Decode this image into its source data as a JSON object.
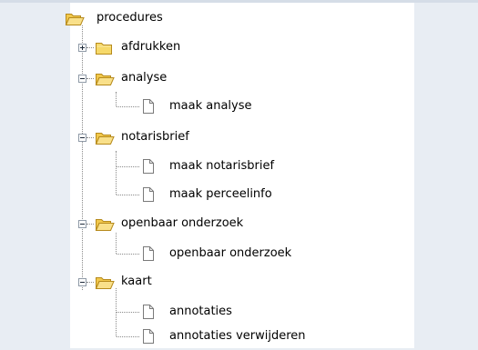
{
  "tree": {
    "root": {
      "label": "procedures",
      "icon": "open-folder-icon",
      "expanded": true
    },
    "items": [
      {
        "label": "afdrukken",
        "icon": "folder-icon",
        "expanded": false
      },
      {
        "label": "analyse",
        "icon": "open-folder-icon",
        "expanded": true
      },
      {
        "label": "maak analyse",
        "icon": "document-icon"
      },
      {
        "label": "notarisbrief",
        "icon": "open-folder-icon",
        "expanded": true
      },
      {
        "label": "maak notarisbrief",
        "icon": "document-icon"
      },
      {
        "label": "maak perceelinfo",
        "icon": "document-icon"
      },
      {
        "label": "openbaar onderzoek",
        "icon": "open-folder-icon",
        "expanded": true
      },
      {
        "label": "openbaar onderzoek",
        "icon": "document-icon"
      },
      {
        "label": "kaart",
        "icon": "open-folder-icon",
        "expanded": true
      },
      {
        "label": "annotaties",
        "icon": "document-icon"
      },
      {
        "label": "annotaties verwijderen",
        "icon": "document-icon"
      }
    ]
  },
  "colors": {
    "folder_fill": "#f6d96a",
    "folder_stroke": "#b68a1c",
    "background": "#e8edf3",
    "panel": "#ffffff"
  }
}
